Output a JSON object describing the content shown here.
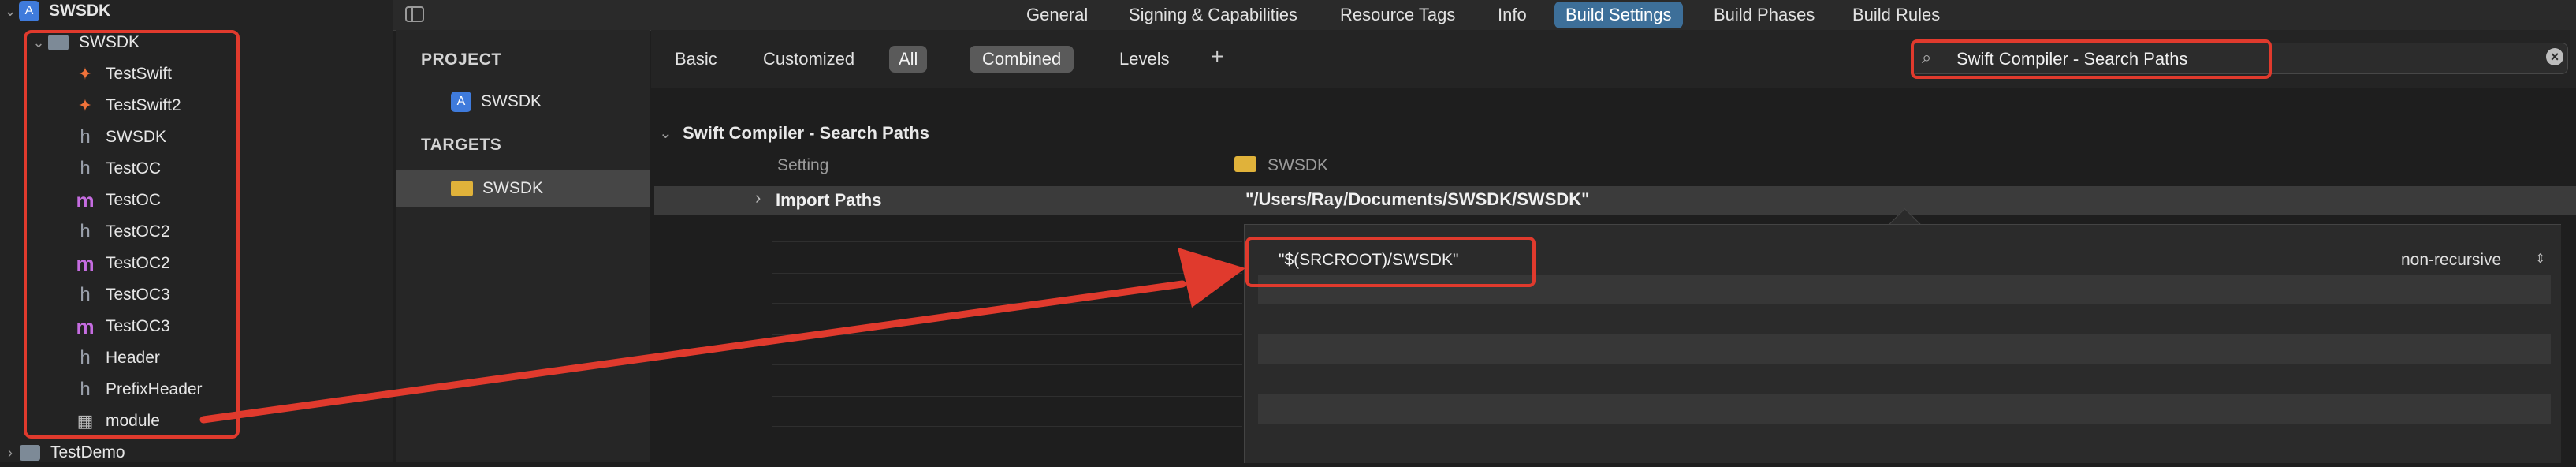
{
  "navigator": {
    "root": {
      "label": "SWSDK"
    },
    "group": {
      "label": "SWSDK"
    },
    "files": [
      {
        "label": "TestSwift",
        "icon": "swift-file-icon"
      },
      {
        "label": "TestSwift2",
        "icon": "swift-file-icon"
      },
      {
        "label": "SWSDK",
        "icon": "header-file-icon"
      },
      {
        "label": "TestOC",
        "icon": "header-file-icon"
      },
      {
        "label": "TestOC",
        "icon": "objc-file-icon"
      },
      {
        "label": "TestOC2",
        "icon": "header-file-icon"
      },
      {
        "label": "TestOC2",
        "icon": "objc-file-icon"
      },
      {
        "label": "TestOC3",
        "icon": "header-file-icon"
      },
      {
        "label": "TestOC3",
        "icon": "objc-file-icon"
      },
      {
        "label": "Header",
        "icon": "header-file-icon"
      },
      {
        "label": "PrefixHeader",
        "icon": "header-file-icon"
      },
      {
        "label": "module",
        "icon": "modulemap-icon"
      }
    ],
    "next_group": {
      "label": "TestDemo"
    }
  },
  "topbar": {
    "tabs": [
      "General",
      "Signing & Capabilities",
      "Resource Tags",
      "Info",
      "Build Settings",
      "Build Phases",
      "Build Rules"
    ],
    "active": "Build Settings"
  },
  "pt": {
    "project_header": "PROJECT",
    "project_item": "SWSDK",
    "targets_header": "TARGETS",
    "target_item": "SWSDK"
  },
  "filter": {
    "basic": "Basic",
    "customized": "Customized",
    "all": "All",
    "combined": "Combined",
    "levels": "Levels",
    "plus": "+",
    "search_value": "Swift Compiler - Search Paths",
    "clear": "×"
  },
  "settings": {
    "section_title": "Swift Compiler - Search Paths",
    "setting_col": "Setting",
    "target_col": "SWSDK",
    "row_name": "Import Paths",
    "row_value": "\"/Users/Ray/Documents/SWSDK/SWSDK\"",
    "popover_value": "\"$(SRCROOT)/SWSDK\"",
    "popover_mode": "non-recursive"
  },
  "colors": {
    "annotation_red": "#e03a2d",
    "active_tab": "#3d6f99"
  }
}
